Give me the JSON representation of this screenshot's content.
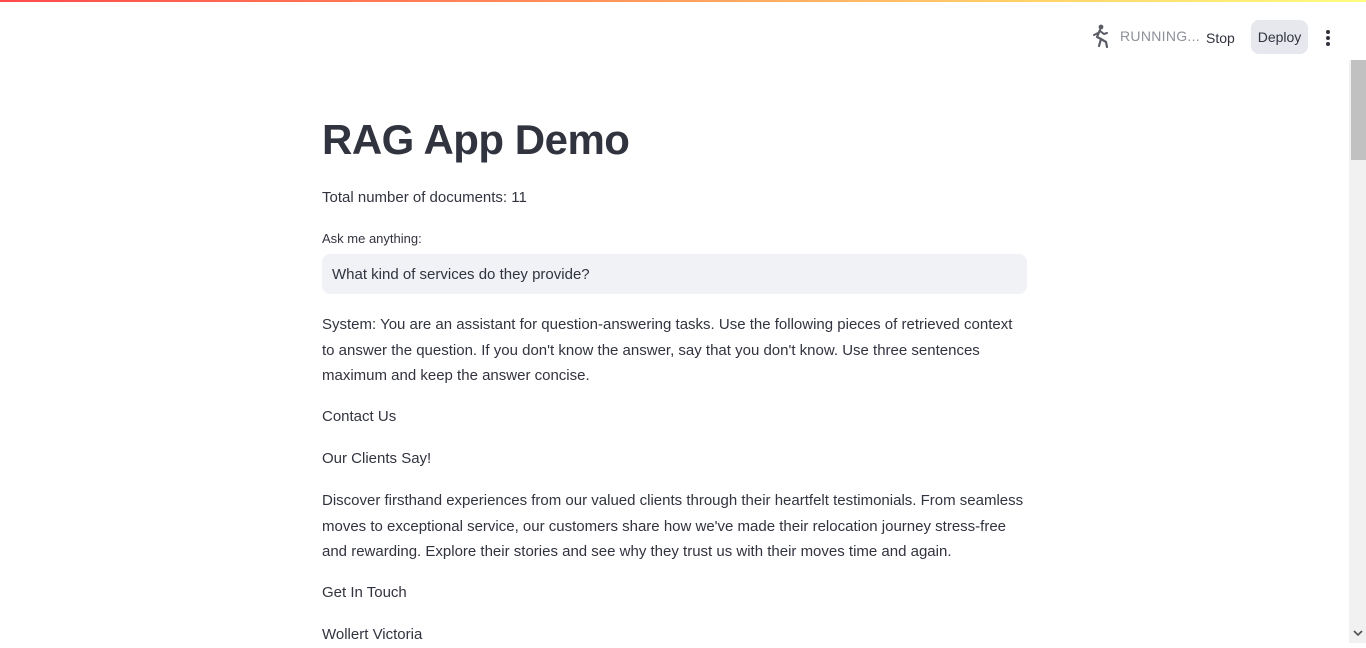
{
  "header": {
    "status_text": "RUNNING...",
    "stop_label": "Stop",
    "deploy_label": "Deploy",
    "status_icon": "running-man-icon",
    "menu_icon": "kebab-menu-icon"
  },
  "main": {
    "title": "RAG App Demo",
    "doc_count": "Total number of documents: 11",
    "input_label": "Ask me anything:",
    "input_value": "What kind of services do they provide?",
    "paragraphs": [
      "System: You are an assistant for question-answering tasks. Use the following pieces of retrieved context to answer the question. If you don't know the answer, say that you don't know. Use three sentences maximum and keep the answer concise.",
      "Contact Us",
      "Our Clients Say!",
      "Discover firsthand experiences from our valued clients through their heartfelt testimonials. From seamless moves to exceptional service, our customers share how we've made their relocation journey stress-free and rewarding. Explore their stories and see why they trust us with their moves time and again.",
      "Get In Touch",
      "Wollert Victoria"
    ]
  },
  "colors": {
    "text": "#31333f",
    "muted": "#8e909a",
    "input_bg": "#f0f2f6",
    "deploy_bg": "#e6e8ee",
    "accent": "#ff4b4b"
  }
}
